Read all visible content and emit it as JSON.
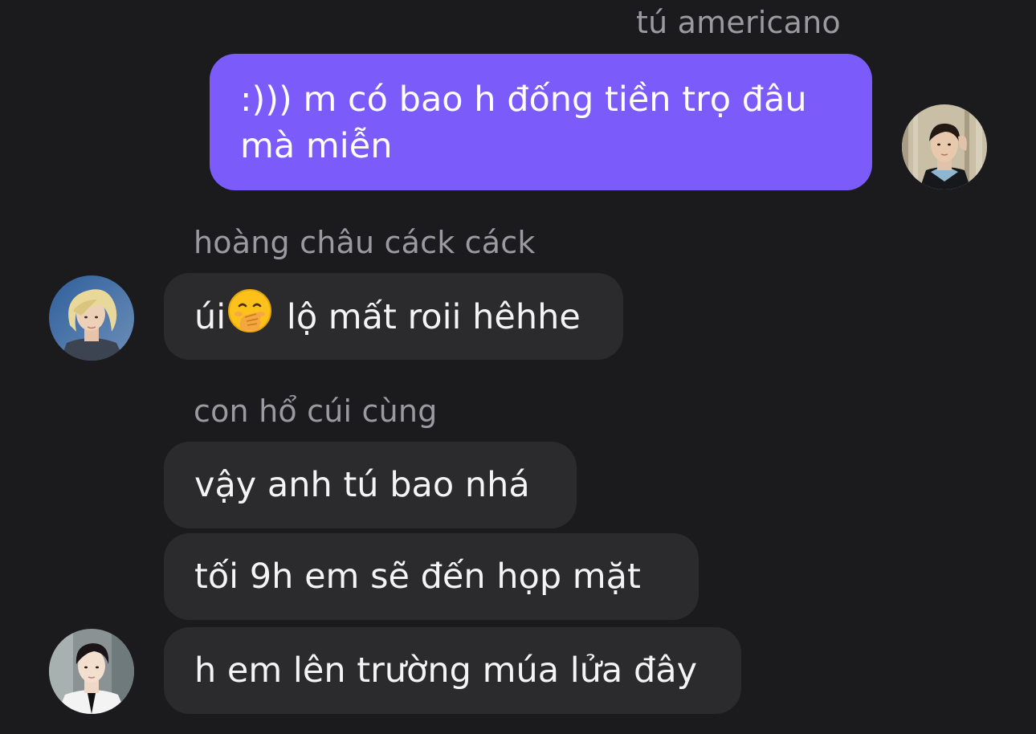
{
  "messages": [
    {
      "sender": "tú americano",
      "direction": "outgoing",
      "lines": [
        ":))) m có bao h đống tiền trọ đâu",
        "mà miễn"
      ]
    },
    {
      "sender": "hoàng châu cáck cáck",
      "direction": "incoming",
      "before_emoji": "úi",
      "emoji": "face-with-hand-over-mouth",
      "after_emoji": " lộ mất roii hêhhe"
    },
    {
      "sender": "con hổ cúi cùng",
      "direction": "incoming",
      "bubbles": [
        "vậy anh tú bao nhá",
        "tối 9h em sẽ đến họp mặt",
        "h em lên trường múa lửa đây"
      ]
    }
  ],
  "colors": {
    "background": "#1b1b1e",
    "outgoing_bubble": "#7b5cfb",
    "incoming_bubble": "#2b2b2e",
    "sender_name": "#9a9aa0"
  }
}
